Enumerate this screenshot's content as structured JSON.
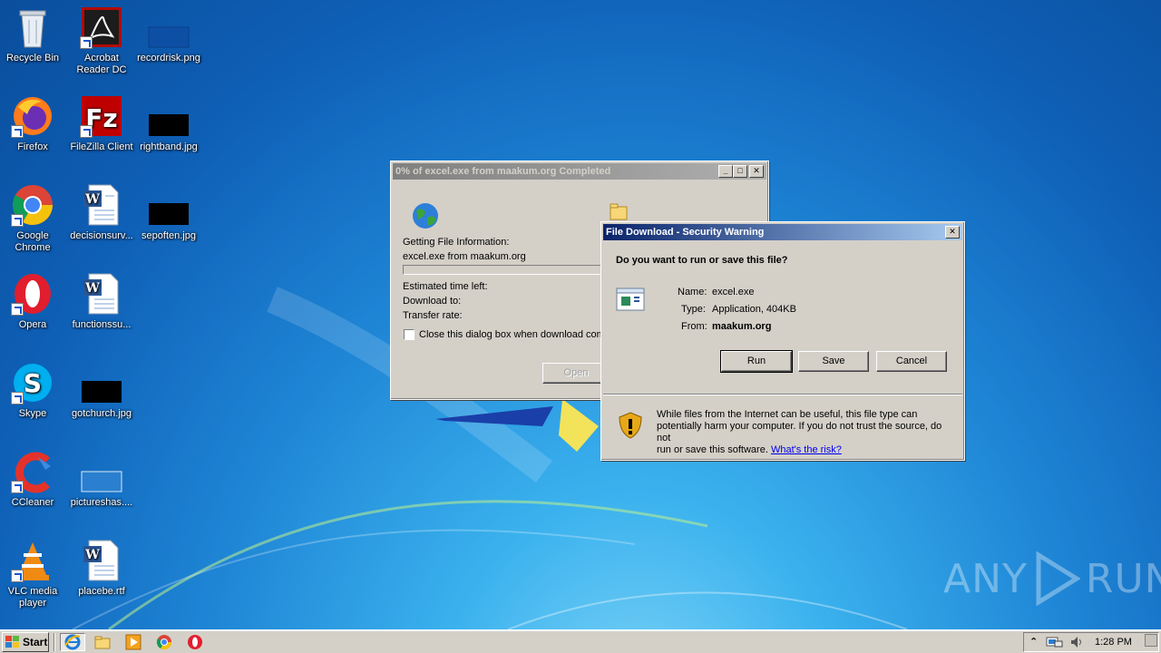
{
  "desktop": {
    "icons": [
      {
        "label": "Recycle Bin"
      },
      {
        "label": "Acrobat Reader DC"
      },
      {
        "label": "recordrisk.png"
      },
      {
        "label": "Firefox"
      },
      {
        "label": "FileZilla Client"
      },
      {
        "label": "rightband.jpg"
      },
      {
        "label": "Google Chrome"
      },
      {
        "label": "decisionsurv..."
      },
      {
        "label": "sepoften.jpg"
      },
      {
        "label": "Opera"
      },
      {
        "label": "functionssu..."
      },
      {
        "label": "Skype"
      },
      {
        "label": "gotchurch.jpg"
      },
      {
        "label": "CCleaner"
      },
      {
        "label": "pictureshas...."
      },
      {
        "label": "VLC media player"
      },
      {
        "label": "placebe.rtf"
      }
    ]
  },
  "download_window": {
    "title": "0% of excel.exe from maakum.org Completed",
    "getting_info": "Getting File Information:",
    "file_from": "excel.exe from maakum.org",
    "estimated_label": "Estimated time left:",
    "download_to_label": "Download to:",
    "transfer_rate_label": "Transfer rate:",
    "close_checkbox_label": "Close this dialog box when download comp",
    "open_button": "Open",
    "progress": 0
  },
  "security_dialog": {
    "title": "File Download - Security Warning",
    "question": "Do you want to run or save this file?",
    "name_label": "Name:",
    "name_value": "excel.exe",
    "type_label": "Type:",
    "type_value": "Application, 404KB",
    "from_label": "From:",
    "from_value": "maakum.org",
    "run_button": "Run",
    "save_button": "Save",
    "cancel_button": "Cancel",
    "warning_text_1": "While files from the Internet can be useful, this file type can",
    "warning_text_2": "potentially harm your computer. If you do not trust the source, do not",
    "warning_text_3": "run or save this software.",
    "risk_link": "What's the risk?"
  },
  "taskbar": {
    "start_label": "Start",
    "clock": "1:28 PM"
  },
  "watermark": {
    "text_left": "ANY",
    "text_right": "RUN"
  }
}
